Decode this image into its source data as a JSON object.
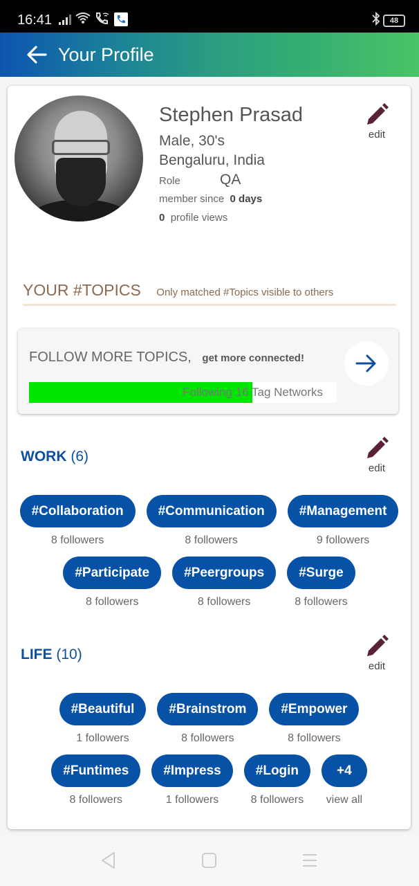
{
  "status_bar": {
    "time": "16:41",
    "battery": "48",
    "icons": [
      "signal-icon",
      "wifi-icon",
      "wifi-calling-icon",
      "phone-app-icon",
      "bluetooth-icon",
      "battery-icon"
    ]
  },
  "app_bar": {
    "title": "Your Profile",
    "back_icon": "arrow-left-icon"
  },
  "profile": {
    "name": "Stephen Prasad",
    "gender_age": "Male,  30's",
    "location": "Bengaluru, India",
    "role_label": "Role",
    "role_value": "QA",
    "member_since_label": "member since",
    "member_since_value": "0 days",
    "profile_views_count": "0",
    "profile_views_label": "profile views",
    "edit_label": "edit"
  },
  "topics_header": {
    "title": "YOUR #TOPICS",
    "subtitle": "Only matched #Topics visible to others"
  },
  "follow_more": {
    "title": "FOLLOW MORE TOPICS,",
    "subtitle": "get more connected!",
    "progress_text": "Following 16 Tag Networks",
    "progress_fraction": 0.726,
    "colors": {
      "fill": "#00e600"
    }
  },
  "sections": [
    {
      "title": "WORK",
      "count": "(6)",
      "edit_label": "edit",
      "rows": [
        [
          {
            "tag": "#Collaboration",
            "sub": "8 followers"
          },
          {
            "tag": "#Communication",
            "sub": "8 followers"
          },
          {
            "tag": "#Management",
            "sub": "9 followers"
          }
        ],
        [
          {
            "tag": "#Participate",
            "sub": "8 followers"
          },
          {
            "tag": "#Peergroups",
            "sub": "8 followers"
          },
          {
            "tag": "#Surge",
            "sub": "8 followers"
          }
        ]
      ]
    },
    {
      "title": "LIFE",
      "count": "(10)",
      "edit_label": "edit",
      "rows": [
        [
          {
            "tag": "#Beautiful",
            "sub": "1 followers"
          },
          {
            "tag": "#Brainstrom",
            "sub": "8 followers"
          },
          {
            "tag": "#Empower",
            "sub": "8 followers"
          }
        ],
        [
          {
            "tag": "#Funtimes",
            "sub": "8 followers"
          },
          {
            "tag": "#Impress",
            "sub": "1 followers"
          },
          {
            "tag": "#Login",
            "sub": "8 followers"
          },
          {
            "tag": "+4",
            "sub": "view all"
          }
        ]
      ]
    }
  ],
  "colors": {
    "accent_blue": "#0752a6",
    "heading_blue": "#0d4f9e",
    "edit_icon": "#5a2238",
    "topics_brown": "#8b6a50"
  },
  "nav_bar": {
    "icons": [
      "back-nav-icon",
      "home-nav-icon",
      "menu-nav-icon"
    ]
  }
}
